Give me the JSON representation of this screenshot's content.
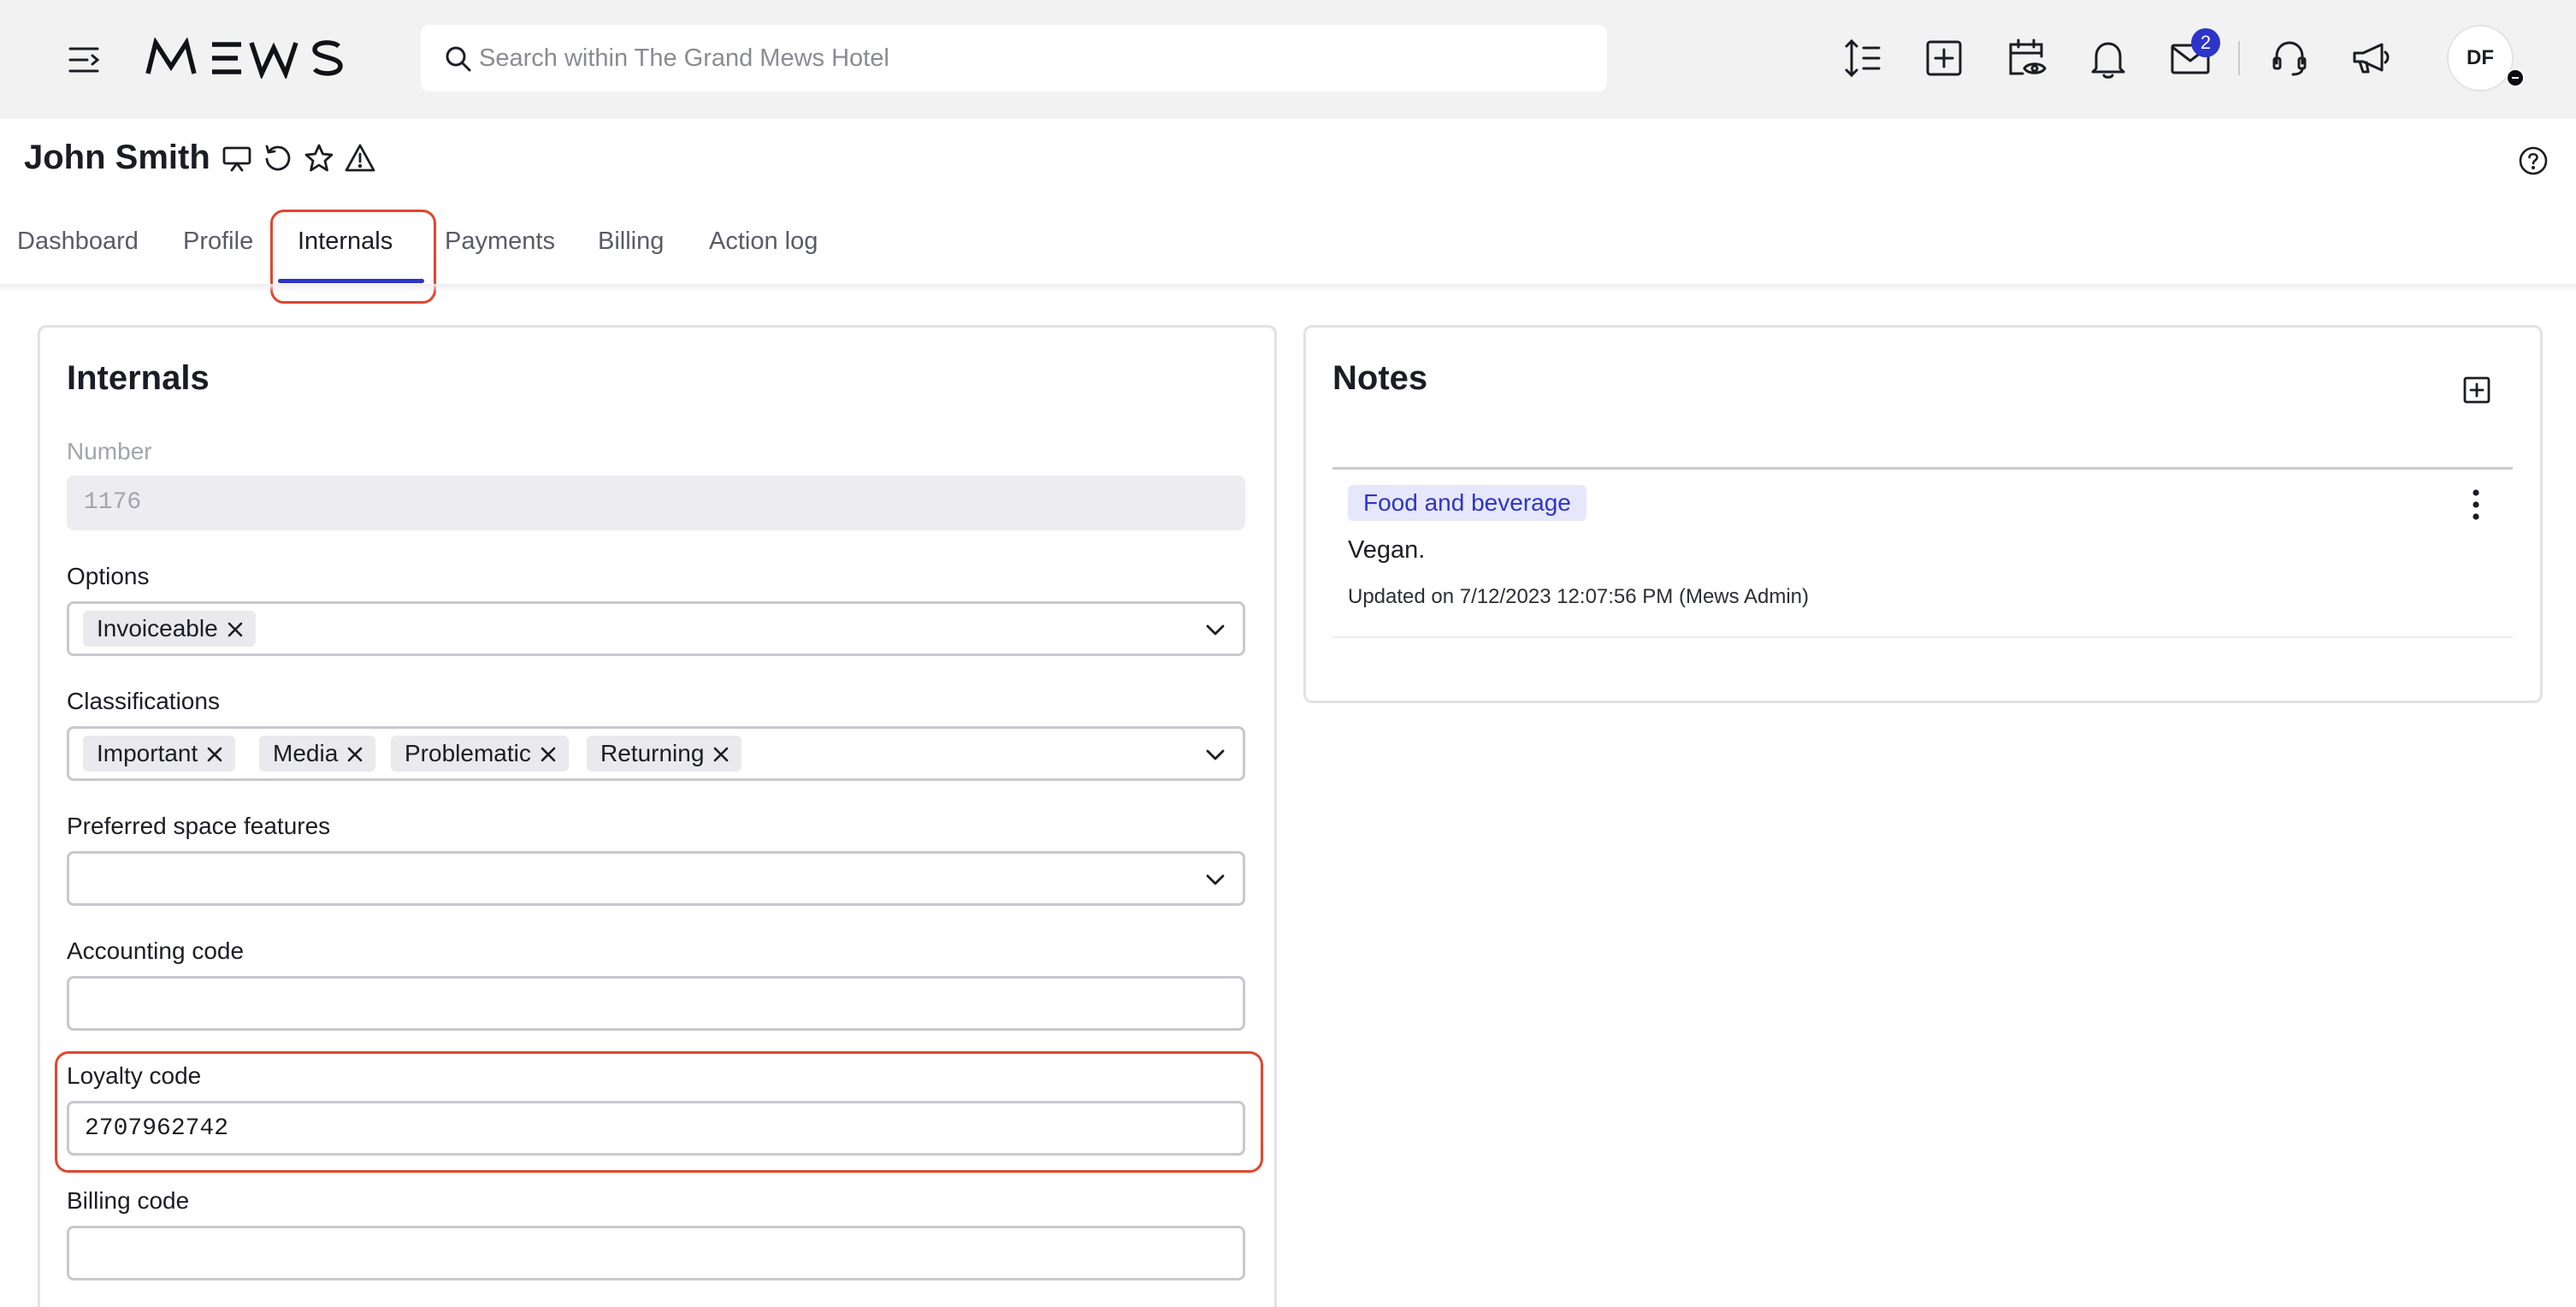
{
  "app": {
    "brand": "MEWS",
    "search_placeholder": "Search within The Grand Mews Hotel",
    "messages_badge": "2",
    "user_initials": "DF"
  },
  "toolbar_icons": [
    "sort-lines-icon",
    "add-square-icon",
    "calendar-eye-icon",
    "bell-icon",
    "mail-icon",
    "headset-icon",
    "megaphone-icon"
  ],
  "profile": {
    "name": "John Smith",
    "title_icons": [
      "presentation-icon",
      "refresh-icon",
      "star-icon",
      "warning-icon"
    ]
  },
  "tabs": [
    {
      "label": "Dashboard"
    },
    {
      "label": "Profile"
    },
    {
      "label": "Internals",
      "active": true
    },
    {
      "label": "Payments"
    },
    {
      "label": "Billing"
    },
    {
      "label": "Action log"
    }
  ],
  "internals": {
    "title": "Internals",
    "number_label": "Number",
    "number_value": "1176",
    "options_label": "Options",
    "options": [
      "Invoiceable"
    ],
    "classifications_label": "Classifications",
    "classifications": [
      "Important",
      "Media",
      "Problematic",
      "Returning"
    ],
    "space_features_label": "Preferred space features",
    "accounting_label": "Accounting code",
    "accounting_value": "",
    "loyalty_label": "Loyalty code",
    "loyalty_value": "2707962742",
    "billing_label": "Billing code",
    "billing_value": ""
  },
  "notes": {
    "title": "Notes",
    "items": [
      {
        "tag": "Food and beverage",
        "text": "Vegan.",
        "meta": "Updated on 7/12/2023 12:07:56 PM (Mews Admin)"
      }
    ]
  },
  "colors": {
    "accent": "#2d35c9",
    "highlight": "#e2452f",
    "topbar_bg": "#f2f2f3",
    "tag_bg": "#e6e7fb"
  }
}
